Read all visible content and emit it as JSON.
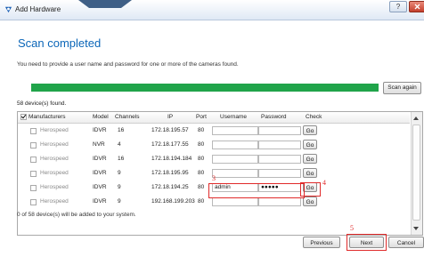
{
  "window": {
    "title": "Add Hardware",
    "help_label": "?"
  },
  "page": {
    "heading": "Scan completed",
    "instruction": "You need to provide a user name and password for one or more of the cameras found.",
    "scan_again_label": "Scan again",
    "progress": 1.0,
    "found_text": "58 device(s) found."
  },
  "table": {
    "columns": [
      "Manufacturers",
      "Model",
      "Channels",
      "IP",
      "Port",
      "Username",
      "Password",
      "Check"
    ],
    "header_checked": true,
    "rows": [
      {
        "manufacturer": "Herospeed",
        "model": "IDVR",
        "channels": "16",
        "ip": "172.18.195.57",
        "port": "80",
        "username": "",
        "password": "",
        "check": "Go"
      },
      {
        "manufacturer": "Herospeed",
        "model": "NVR",
        "channels": "4",
        "ip": "172.18.177.55",
        "port": "80",
        "username": "",
        "password": "",
        "check": "Go"
      },
      {
        "manufacturer": "Herospeed",
        "model": "IDVR",
        "channels": "16",
        "ip": "172.18.194.184",
        "port": "80",
        "username": "",
        "password": "",
        "check": "Go"
      },
      {
        "manufacturer": "Herospeed",
        "model": "IDVR",
        "channels": "9",
        "ip": "172.18.195.95",
        "port": "80",
        "username": "",
        "password": "",
        "check": "Go"
      },
      {
        "manufacturer": "Herospeed",
        "model": "IDVR",
        "channels": "9",
        "ip": "172.18.194.25",
        "port": "80",
        "username": "admin",
        "password": "●●●●●",
        "check": "Go"
      },
      {
        "manufacturer": "Herospeed",
        "model": "IDVR",
        "channels": "9",
        "ip": "192.168.199.203",
        "port": "80",
        "username": "",
        "password": "",
        "check": "Go"
      }
    ]
  },
  "annotations": {
    "a3": "3",
    "a4": "4",
    "a5": "5"
  },
  "summary": "0 of 58 device(s) will be added to your system.",
  "buttons": {
    "previous": "Previous",
    "next": "Next",
    "cancel": "Cancel"
  },
  "colors": {
    "accent": "#0b66b8",
    "progress": "#20a44a",
    "annotation": "#e02a2a"
  },
  "icons": {
    "app": "camera-icon",
    "close": "close-icon",
    "help": "help-icon"
  }
}
